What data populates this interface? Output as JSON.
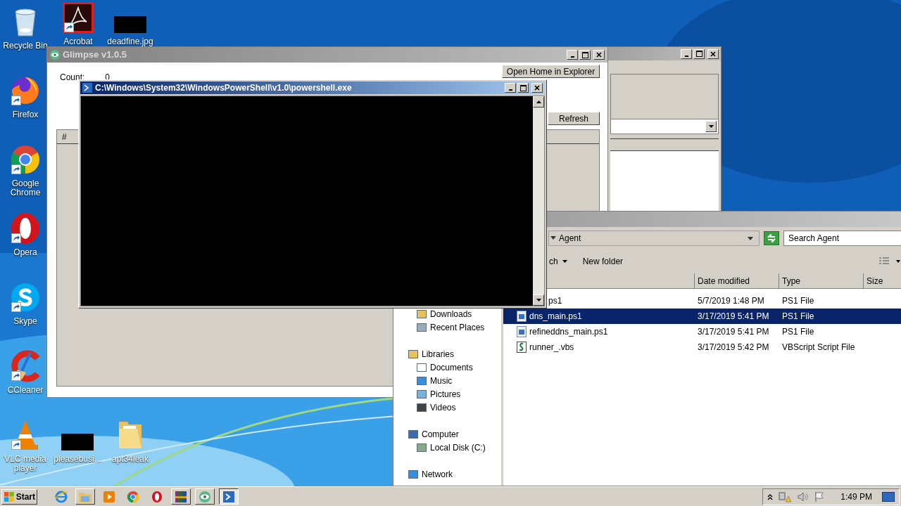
{
  "desktop_icons": [
    {
      "label": "Recycle Bin",
      "kind": "recycle",
      "shortcut": false
    },
    {
      "label": "Acrobat",
      "kind": "acrobat",
      "shortcut": true
    },
    {
      "label": "deadfine.jpg",
      "kind": "blackout",
      "shortcut": false
    },
    {
      "label": "Firefox",
      "kind": "firefox",
      "shortcut": true
    },
    {
      "label": "Google Chrome",
      "kind": "chrome",
      "shortcut": true
    },
    {
      "label": "Opera",
      "kind": "opera",
      "shortcut": true
    },
    {
      "label": "Skype",
      "kind": "skype",
      "shortcut": true
    },
    {
      "label": "CCleaner",
      "kind": "ccleaner",
      "shortcut": true
    },
    {
      "label": "VLC media player",
      "kind": "vlc",
      "shortcut": true
    },
    {
      "label": "pleasebusi...",
      "kind": "blackout",
      "shortcut": false
    },
    {
      "label": "apt34leak",
      "kind": "folder",
      "shortcut": false
    }
  ],
  "glimpse": {
    "title": "Glimpse v1.0.5",
    "count_label": "Count:",
    "count_value": "0",
    "open_button": "Open Home in Explorer",
    "refresh_button": "Refresh",
    "table": {
      "columns": [
        "#"
      ]
    }
  },
  "explorer": {
    "breadcrumb": "Agent",
    "search": {
      "placeholder": "Search Agent"
    },
    "toolbar": [
      "ch",
      "New folder"
    ],
    "columns": [
      "Date modified",
      "Type",
      "Size"
    ],
    "nav": [
      {
        "children": [
          {
            "label": "Downloads",
            "kind": "downloads"
          },
          {
            "label": "Recent Places",
            "kind": "recent"
          }
        ]
      },
      {
        "label": "Libraries",
        "kind": "library",
        "children": [
          {
            "label": "Documents",
            "kind": "document"
          },
          {
            "label": "Music",
            "kind": "music"
          },
          {
            "label": "Pictures",
            "kind": "picture"
          },
          {
            "label": "Videos",
            "kind": "video"
          }
        ]
      },
      {
        "label": "Computer",
        "kind": "computer",
        "children": [
          {
            "label": "Local Disk (C:)",
            "kind": "disk"
          }
        ]
      },
      {
        "label": "Network",
        "kind": "network"
      }
    ],
    "files": [
      {
        "name": "ps1",
        "kind": "clipped",
        "date": "5/7/2019 1:48 PM",
        "type": "PS1 File",
        "selected": false
      },
      {
        "name": "dns_main.ps1",
        "kind": "ps1",
        "date": "3/17/2019 5:41 PM",
        "type": "PS1 File",
        "selected": true
      },
      {
        "name": "refineddns_main.ps1",
        "kind": "ps1",
        "date": "3/17/2019 5:41 PM",
        "type": "PS1 File",
        "selected": false
      },
      {
        "name": "runner_.vbs",
        "kind": "vbs",
        "date": "3/17/2019 5:42 PM",
        "type": "VBScript Script File",
        "selected": false
      }
    ]
  },
  "powershell": {
    "title": "C:\\Windows\\System32\\WindowsPowerShell\\v1.0\\powershell.exe"
  },
  "taskbar": {
    "start": "Start",
    "apps": [
      {
        "kind": "ie",
        "running": false,
        "selected": false
      },
      {
        "kind": "explorer",
        "running": true,
        "selected": false
      },
      {
        "kind": "media",
        "running": false,
        "selected": false
      },
      {
        "kind": "chrome",
        "running": false,
        "selected": false
      },
      {
        "kind": "opera",
        "running": false,
        "selected": false
      },
      {
        "kind": "archive",
        "running": true,
        "selected": false
      },
      {
        "kind": "glimpse",
        "running": true,
        "selected": false
      },
      {
        "kind": "powershell",
        "running": true,
        "selected": true
      }
    ],
    "time": "1:49 PM"
  }
}
